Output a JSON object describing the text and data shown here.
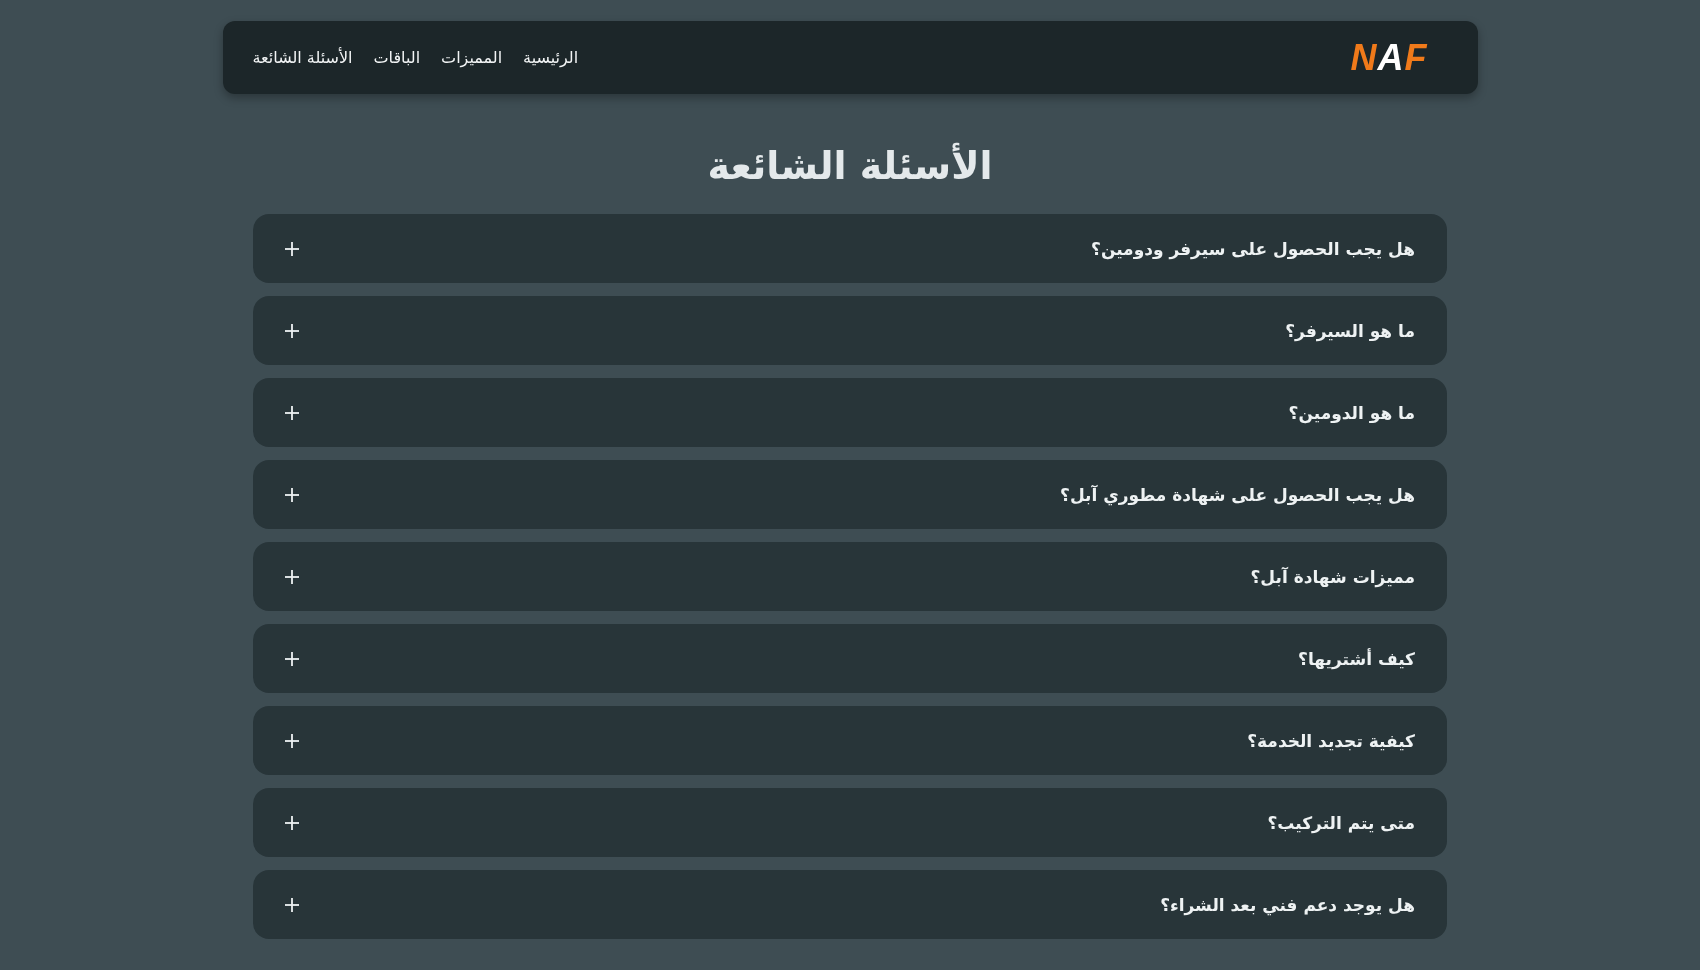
{
  "header": {
    "logo": "NAF",
    "nav": [
      "الرئيسية",
      "المميزات",
      "الباقات",
      "الأسئلة الشائعة"
    ]
  },
  "title": "الأسئلة الشائعة",
  "faq": [
    {
      "question": "هل يجب الحصول على سيرفر ودومين؟",
      "expanded": false
    },
    {
      "question": "ما هو السيرفر؟",
      "expanded": false
    },
    {
      "question": "ما هو الدومين؟",
      "expanded": false
    },
    {
      "question": "هل يجب الحصول على شهادة مطوري آبل؟",
      "expanded": false
    },
    {
      "question": "مميزات شهادة آبل؟",
      "expanded": false
    },
    {
      "question": "كيف أشتريها؟",
      "expanded": false
    },
    {
      "question": "كيفية تجديد الخدمة؟",
      "expanded": false
    },
    {
      "question": "متى يتم التركيب؟",
      "expanded": false
    },
    {
      "question": "هل يوجد دعم فني بعد الشراء؟",
      "expanded": false
    }
  ]
}
